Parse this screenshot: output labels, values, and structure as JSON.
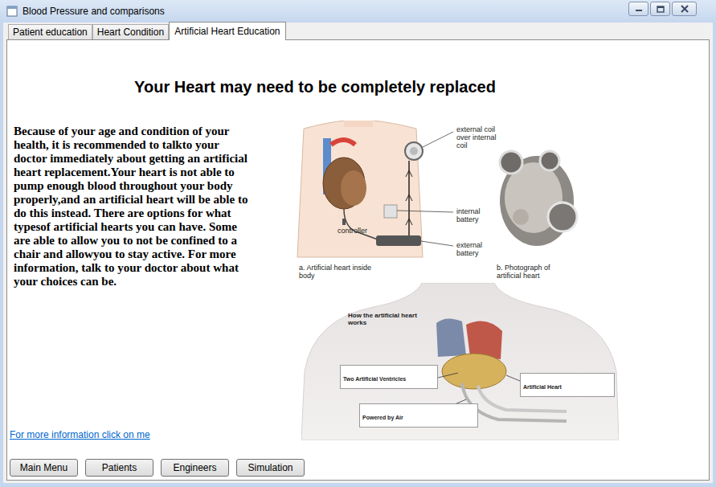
{
  "window": {
    "title": "Blood Pressure and comparisons"
  },
  "tabs": [
    {
      "label": "Patient education",
      "selected": false
    },
    {
      "label": "Heart Condition",
      "selected": false
    },
    {
      "label": "Artificial Heart Education",
      "selected": true
    }
  ],
  "content": {
    "heading": "Your Heart may need to be completely replaced",
    "paragraph": "Because of your age and condition of your health, it is recommended to talkto your doctor immediately about getting an artificial heart replacement.Your heart is not able to pump enough blood throughout your body properly,and an artificial heart will be able to do this instead. There are options for what typesof artificial hearts you can have. Some are able to allow you to not be confined to a chair and allowyou to stay active. For more information, talk to your doctor about what your choices can be.",
    "link": "For more information click on me"
  },
  "figure_a": {
    "coil_label": "external coil over internal coil",
    "internal_battery_label": "internal battery",
    "external_battery_label": "external battery",
    "controller_label": "controller",
    "caption_a": "a. Artificial heart inside body",
    "caption_b": "b. Photograph of artificial heart"
  },
  "figure_b": {
    "title": "How the artificial heart works",
    "labels": [
      "Two Artificial Ventricles",
      "Artificial Heart",
      "Powered by Air"
    ]
  },
  "buttons": [
    "Main Menu",
    "Patients",
    "Engineers",
    "Simulation"
  ]
}
